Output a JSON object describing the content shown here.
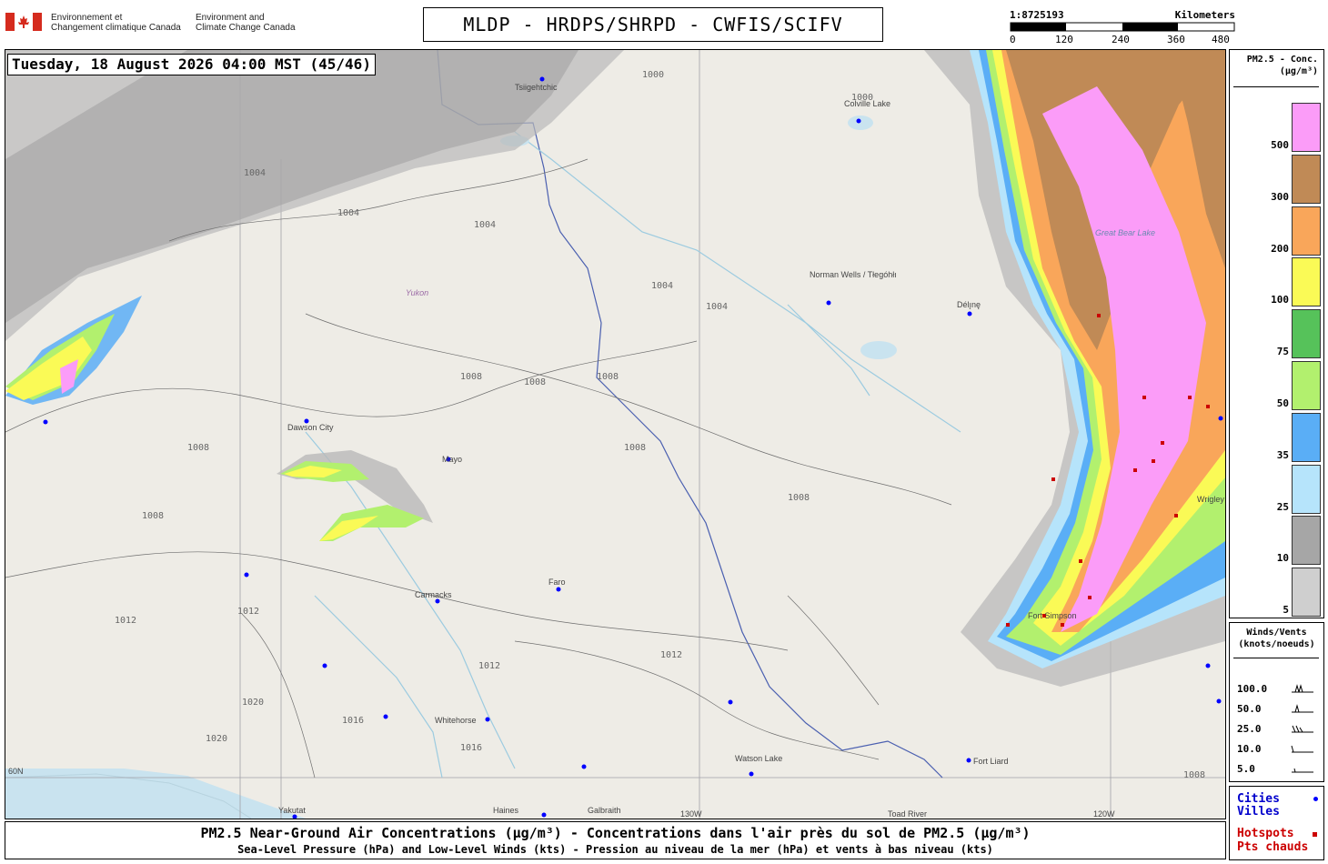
{
  "header": {
    "org_fr_1": "Environnement et",
    "org_fr_2": "Changement climatique Canada",
    "org_en_1": "Environment and",
    "org_en_2": "Climate Change Canada",
    "title": "MLDP - HRDPS/SHRPD - CWFIS/SCIFV"
  },
  "scale": {
    "ratio": "1:8725193",
    "unit": "Kilometers",
    "ticks": [
      "0",
      "120",
      "240",
      "360",
      "480"
    ]
  },
  "map": {
    "timestamp": "Tuesday, 18 August 2026 04:00 MST (45/46)",
    "region_label": "Yukon",
    "lake_label": "Great Bear Lake",
    "cities": [
      {
        "name": "Tsiigehtchic"
      },
      {
        "name": "Colville Lake"
      },
      {
        "name": "Norman Wells / Tłegóhłı"
      },
      {
        "name": "Délı̨nę"
      },
      {
        "name": "Dawson City"
      },
      {
        "name": "Mayo"
      },
      {
        "name": "Carmacks"
      },
      {
        "name": "Faro"
      },
      {
        "name": "Whitehorse"
      },
      {
        "name": "Watson Lake"
      },
      {
        "name": "Fort Liard"
      },
      {
        "name": "Yakutat"
      },
      {
        "name": "Haines"
      },
      {
        "name": "Galbraith"
      },
      {
        "name": "Toad River"
      },
      {
        "name": "Fort Simpson"
      },
      {
        "name": "Wrigley"
      }
    ],
    "graticule": [
      "60N",
      "130W",
      "120W"
    ],
    "isobars": [
      "1000",
      "1004",
      "1008",
      "1012",
      "1016",
      "1020"
    ],
    "colors": {
      "land": "#eeece6",
      "water": "#c9e3ef",
      "border": "#4a5fb0"
    }
  },
  "pm25_legend": {
    "title_1": "PM2.5 - Conc.",
    "title_2": "(µg/m³)",
    "levels": [
      {
        "label": "500",
        "color": "#fb9cf8"
      },
      {
        "label": "300",
        "color": "#c08a56"
      },
      {
        "label": "200",
        "color": "#f9a65a"
      },
      {
        "label": "100",
        "color": "#fafa56"
      },
      {
        "label": "75",
        "color": "#56c25a"
      },
      {
        "label": "50",
        "color": "#b2f06e"
      },
      {
        "label": "35",
        "color": "#5aaef6"
      },
      {
        "label": "25",
        "color": "#b6e4fb"
      },
      {
        "label": "10",
        "color": "#a6a6a6"
      },
      {
        "label": "5",
        "color": "#cfcfcf"
      }
    ]
  },
  "wind_legend": {
    "title_1": "Winds/Vents",
    "title_2": "(knots/noeuds)",
    "rows": [
      "100.0",
      "50.0",
      "25.0",
      "10.0",
      "5.0"
    ]
  },
  "point_legend": {
    "cities_en": "Cities",
    "cities_fr": "Villes",
    "hotspots_en": "Hotspots",
    "hotspots_fr": "Pts chauds",
    "city_color": "#0000ff",
    "hotspot_color": "#cc0000"
  },
  "footer": {
    "line1": "PM2.5 Near-Ground Air Concentrations (µg/m³) - Concentrations dans l'air près du sol de PM2.5 (µg/m³)",
    "line2": "Sea-Level Pressure (hPa) and Low-Level Winds (kts) - Pression au niveau de la mer (hPa) et vents à bas niveau (kts)"
  }
}
